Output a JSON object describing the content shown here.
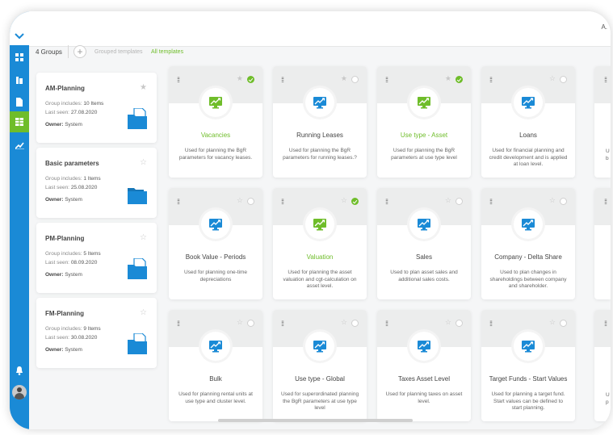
{
  "header": {
    "user_short": "A."
  },
  "toolbar": {
    "groups_count": "4 Groups",
    "add_symbol": "+",
    "tab_grouped": "Grouped templates",
    "tab_all": "All templates"
  },
  "colors": {
    "rail": "#1a8ad6",
    "accent": "#6fbd2a",
    "icon_blue": "#1a8ad6"
  },
  "nav_icons": [
    "chevron-down-icon",
    "dashboard-icon",
    "buildings-icon",
    "document-icon",
    "table-icon",
    "chart-icon",
    "bell-icon",
    "avatar"
  ],
  "groups": [
    {
      "title": "AM-Planning",
      "includes_label": "Group includes:",
      "includes": "10 Items",
      "seen_label": "Last seen:",
      "seen": "27.08.2020",
      "owner_label": "Owner:",
      "owner": "System",
      "starred": true
    },
    {
      "title": "Basic parameters",
      "includes_label": "Group includes:",
      "includes": "1 Items",
      "seen_label": "Last seen:",
      "seen": "25.08.2020",
      "owner_label": "Owner:",
      "owner": "System",
      "starred": false
    },
    {
      "title": "PM-Planning",
      "includes_label": "Group includes:",
      "includes": "5 Items",
      "seen_label": "Last seen:",
      "seen": "08.09.2020",
      "owner_label": "Owner:",
      "owner": "System",
      "starred": false
    },
    {
      "title": "FM-Planning",
      "includes_label": "Group includes:",
      "includes": "9 Items",
      "seen_label": "Last seen:",
      "seen": "30.08.2020",
      "owner_label": "Owner:",
      "owner": "System",
      "starred": false
    }
  ],
  "templates": [
    {
      "title": "Vacancies",
      "desc": "Used for planning the BgR parameters for vacancy leases.",
      "selected": true,
      "starred": true
    },
    {
      "title": "Running Leases",
      "desc": "Used for planning the BgR parameters for running leases.?",
      "selected": false,
      "starred": true
    },
    {
      "title": "Use type - Asset",
      "desc": "Used for planning the BgR parameters at use type level",
      "selected": true,
      "starred": true
    },
    {
      "title": "Loans",
      "desc": "Used for financial planning and credit development and is applied at loan level.",
      "selected": false,
      "starred": false
    },
    {
      "title": "Book Value - Periods",
      "desc": "Used for planning one-time depreciations",
      "selected": false,
      "starred": false
    },
    {
      "title": "Valuation",
      "desc": "Used for planning the asset valuation and cgt-calculation on asset level.",
      "selected": true,
      "starred": false
    },
    {
      "title": "Sales",
      "desc": "Used to plan asset sales and additional sales costs.",
      "selected": false,
      "starred": false
    },
    {
      "title": "Company - Delta Share",
      "desc": "Used to plan changes in shareholdings between company and shareholder.",
      "selected": false,
      "starred": false
    },
    {
      "title": "Bulk",
      "desc": "Used for planning rental units at use type and cluster level.",
      "selected": false,
      "starred": false
    },
    {
      "title": "Use type - Global",
      "desc": "Used for superordinated planning the BgR parameters at use type level",
      "selected": false,
      "starred": false
    },
    {
      "title": "Taxes Asset Level",
      "desc": "Used for planning taxes on asset level.",
      "selected": false,
      "starred": false
    },
    {
      "title": "Target Funds - Start Values",
      "desc": "Used for planning a target fund. Start values can be defined to start planning.",
      "selected": false,
      "starred": false
    }
  ],
  "partial_column": [
    {
      "desc": "U\nb"
    },
    {
      "desc": ""
    },
    {
      "desc": "U\np"
    }
  ]
}
